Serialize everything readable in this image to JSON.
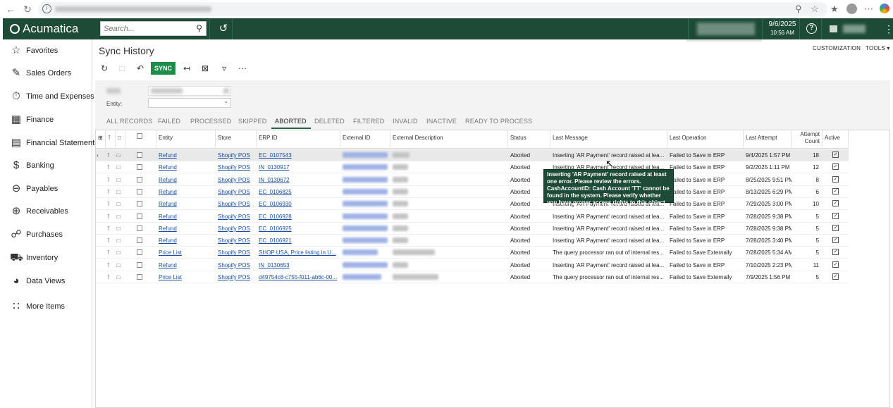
{
  "browser": {
    "icons": [
      "back-icon",
      "reload-icon",
      "info-icon",
      "zoom-icon",
      "star-icon",
      "favorites-icon",
      "profile-icon",
      "menu-icon",
      "ai-icon"
    ]
  },
  "topbar": {
    "brand": "Acumatica",
    "search_placeholder": "Search...",
    "date": "9/6/2025",
    "time": "10:56 AM",
    "help": "?"
  },
  "sidebar": {
    "items": [
      {
        "label": "Favorites",
        "icon": "star-icon"
      },
      {
        "label": "Sales Orders",
        "icon": "edit-icon"
      },
      {
        "label": "Time and Expenses",
        "icon": "clock-icon"
      },
      {
        "label": "Finance",
        "icon": "calculator-icon"
      },
      {
        "label": "Financial Statements",
        "icon": "document-icon"
      },
      {
        "label": "Banking",
        "icon": "dollar-icon"
      },
      {
        "label": "Payables",
        "icon": "minus-circle-icon"
      },
      {
        "label": "Receivables",
        "icon": "plus-circle-icon"
      },
      {
        "label": "Purchases",
        "icon": "cart-icon"
      },
      {
        "label": "Inventory",
        "icon": "truck-icon"
      },
      {
        "label": "Data Views",
        "icon": "chart-icon"
      },
      {
        "label": "More Items",
        "icon": "grid-icon"
      }
    ]
  },
  "page": {
    "title": "Sync History",
    "customization": "CUSTOMIZATION",
    "tools": "TOOLS",
    "sync_button": "SYNC",
    "entity_label": "Entity:"
  },
  "tabs": [
    "ALL RECORDS",
    "FAILED",
    "PROCESSED",
    "SKIPPED",
    "ABORTED",
    "DELETED",
    "FILTERED",
    "INVALID",
    "INACTIVE",
    "READY TO PROCESS"
  ],
  "active_tab": "ABORTED",
  "columns": {
    "entity": "Entity",
    "store": "Store",
    "erp_id": "ERP ID",
    "external_id": "External ID",
    "external_description": "External Description",
    "status": "Status",
    "last_message": "Last Message",
    "last_operation": "Last Operation",
    "last_attempt": "Last Attempt",
    "attempt_count_1": "Attempt",
    "attempt_count_2": "Count",
    "active": "Active"
  },
  "rows": [
    {
      "entity": "Refund",
      "store": "Shopify POS",
      "erp_id": "EC_0107543",
      "status": "Aborted",
      "message": "Inserting 'AR Payment' record raised at lea...",
      "operation": "Failed to Save in ERP",
      "attempt": "9/4/2025 1:57 PM",
      "count": "18"
    },
    {
      "entity": "Refund",
      "store": "Shopify POS",
      "erp_id": "IN_0130917",
      "status": "Aborted",
      "message": "Inserting 'AR Payment' record raised at lea...",
      "operation": "Failed to Save in ERP",
      "attempt": "9/2/2025 1:11 PM",
      "count": "12"
    },
    {
      "entity": "Refund",
      "store": "Shopify POS",
      "erp_id": "IN_0130672",
      "status": "Aborted",
      "message": "Inserting 'AR Payment' record raised at lea...",
      "operation": "Failed to Save in ERP",
      "attempt": "8/25/2025 9:51 PM",
      "count": "8"
    },
    {
      "entity": "Refund",
      "store": "Shopify POS",
      "erp_id": "EC_0106825",
      "status": "Aborted",
      "message": "Inserting 'AR Payment' record raised at lea...",
      "operation": "Failed to Save in ERP",
      "attempt": "8/13/2025 6:29 PM",
      "count": "6"
    },
    {
      "entity": "Refund",
      "store": "Shopify POS",
      "erp_id": "EC_0106930",
      "status": "Aborted",
      "message": "Inserting 'AR Payment' record raised at lea...",
      "operation": "Failed to Save in ERP",
      "attempt": "7/29/2025 3:00 PM",
      "count": "10"
    },
    {
      "entity": "Refund",
      "store": "Shopify POS",
      "erp_id": "EC_0106928",
      "status": "Aborted",
      "message": "Inserting 'AR Payment' record raised at lea...",
      "operation": "Failed to Save in ERP",
      "attempt": "7/28/2025 9:38 PM",
      "count": "5"
    },
    {
      "entity": "Refund",
      "store": "Shopify POS",
      "erp_id": "EC_0106925",
      "status": "Aborted",
      "message": "Inserting 'AR Payment' record raised at lea...",
      "operation": "Failed to Save in ERP",
      "attempt": "7/28/2025 9:38 PM",
      "count": "5"
    },
    {
      "entity": "Refund",
      "store": "Shopify POS",
      "erp_id": "EC_0106921",
      "status": "Aborted",
      "message": "Inserting 'AR Payment' record raised at lea...",
      "operation": "Failed to Save in ERP",
      "attempt": "7/28/2025 3:40 PM",
      "count": "5"
    },
    {
      "entity": "Price List",
      "store": "Shopify POS",
      "erp_id": "SHOP USA, Price listing in U...",
      "status": "Aborted",
      "message": "The query processor ran out of internal res...",
      "operation": "Failed to Save Externally",
      "attempt": "7/28/2025 5:34 AM",
      "count": "5"
    },
    {
      "entity": "Refund",
      "store": "Shopify POS",
      "erp_id": "IN_0130653",
      "status": "Aborted",
      "message": "Inserting 'AR Payment' record raised at lea...",
      "operation": "Failed to Save in ERP",
      "attempt": "7/10/2025 2:23 PM",
      "count": "11"
    },
    {
      "entity": "Price List",
      "store": "Shopify POS",
      "erp_id": "d49754c8-c755-f011-ab6c-00...",
      "status": "Aborted",
      "message": "The query processor ran out of internal res...",
      "operation": "Failed to Save Externally",
      "attempt": "7/9/2025 1:56 PM",
      "count": "5"
    }
  ],
  "tooltip": "Inserting 'AR Payment' record raised at least one error. Please review the errors. CashAccountID: Cash Account 'TT' cannot be found in the system. Please verify whether you have proper access rights to this object."
}
